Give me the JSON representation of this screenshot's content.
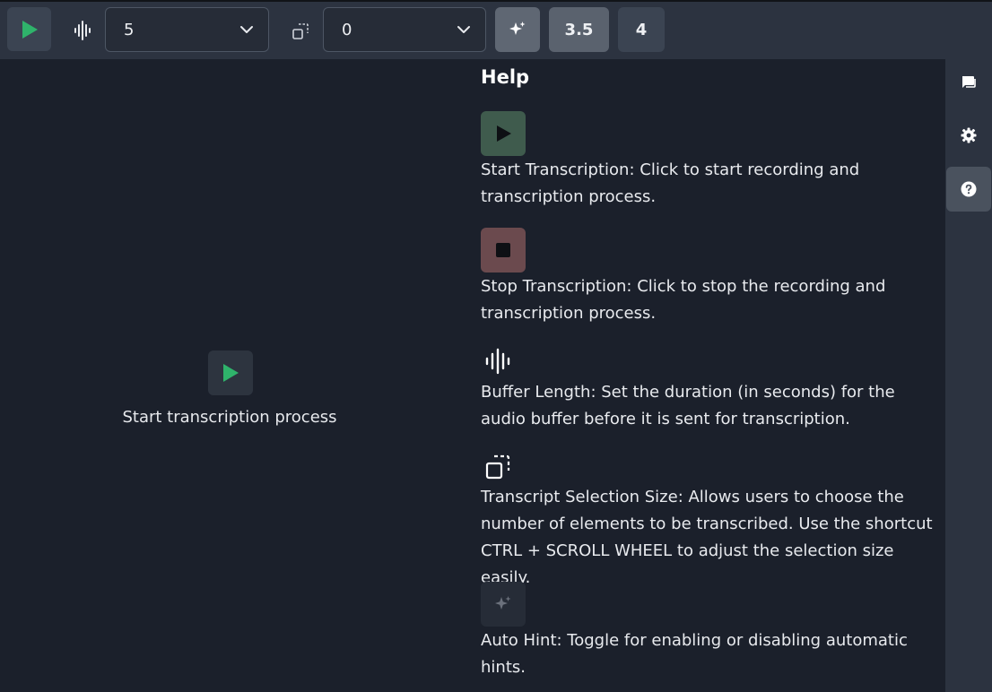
{
  "toolbar": {
    "buffer_length_value": "5",
    "selection_size_value": "0",
    "option_3_5": "3.5",
    "option_4": "4"
  },
  "main": {
    "start_label": "Start transcription process"
  },
  "help": {
    "title": "Help",
    "items": [
      {
        "icon": "play-icon",
        "text": "Start Transcription: Click to start recording and transcription process."
      },
      {
        "icon": "stop-icon",
        "text": "Stop Transcription: Click to stop the recording and transcription process."
      },
      {
        "icon": "waveform-icon",
        "text": "Buffer Length: Set the duration (in seconds) for the audio buffer before it is sent for transcription."
      },
      {
        "icon": "selection-size-icon",
        "text": "Transcript Selection Size: Allows users to choose the number of elements to be transcribed. Use the shortcut CTRL + SCROLL WHEEL to adjust the selection size easily."
      },
      {
        "icon": "sparkle-icon",
        "text": "Auto Hint: Toggle for enabling or disabling automatic hints."
      }
    ]
  },
  "sidebar": {
    "items": [
      "transcript-icon",
      "settings-icon",
      "help-icon"
    ]
  },
  "colors": {
    "play_green": "#2fb36b",
    "start_box": "#3f5b4d",
    "stop_box": "#6b4a4e",
    "active_sidebar": "#4a525e"
  }
}
